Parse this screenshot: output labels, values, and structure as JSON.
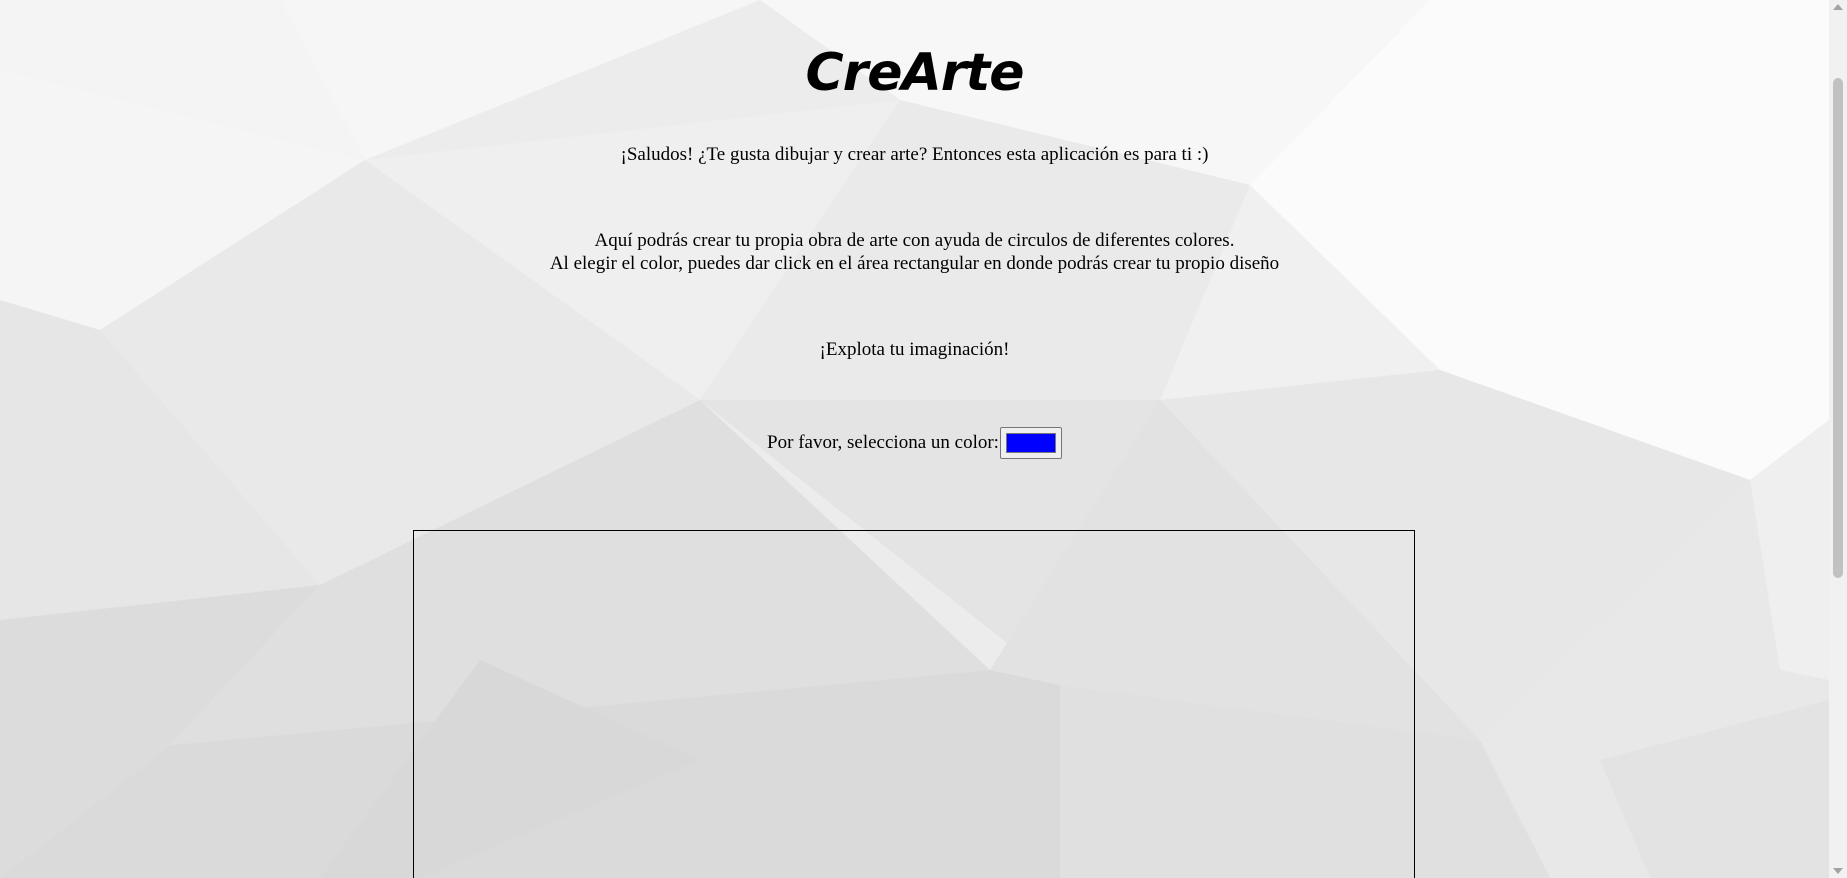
{
  "page": {
    "title": "CreArte",
    "greeting": "¡Saludos! ¿Te gusta dibujar y crear arte? Entonces esta aplicación es para ti :)",
    "instructions_line1": "Aquí podrás crear tu propia obra de arte con ayuda de circulos de diferentes colores.",
    "instructions_line2": "Al elegir el color, puedes dar click en el área rectangular en donde podrás crear tu propio diseño",
    "motto": "¡Explota tu imaginación!"
  },
  "color_picker": {
    "label": "Por favor, selecciona un color:",
    "selected_color": "#0000ff"
  },
  "canvas": {
    "background": "transparent",
    "border_color": "#000000"
  },
  "scrollbar": {
    "up_icon": "triangle-up-icon",
    "down_icon": "triangle-down-icon"
  }
}
